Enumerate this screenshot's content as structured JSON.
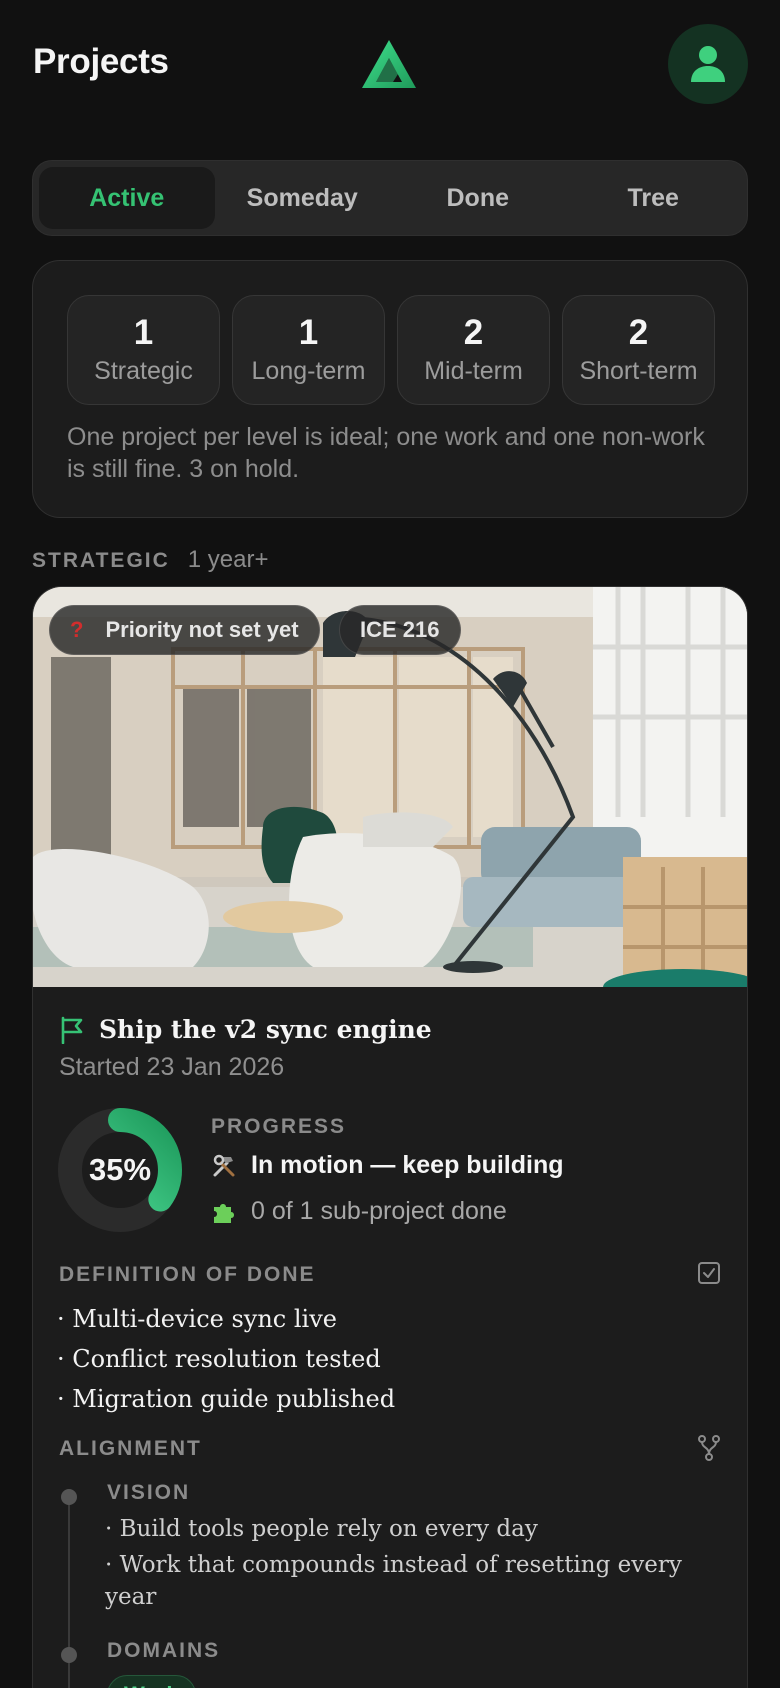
{
  "header": {
    "title": "Projects",
    "logo_icon": "triangle-logo-icon",
    "avatar_icon": "user-icon"
  },
  "tabs": [
    {
      "label": "Active",
      "selected": true
    },
    {
      "label": "Someday",
      "selected": false
    },
    {
      "label": "Done",
      "selected": false
    },
    {
      "label": "Tree",
      "selected": false
    }
  ],
  "levels": {
    "items": [
      {
        "count": "1",
        "label": "Strategic"
      },
      {
        "count": "1",
        "label": "Long-term"
      },
      {
        "count": "2",
        "label": "Mid-term"
      },
      {
        "count": "2",
        "label": "Short-term"
      }
    ],
    "note": "One project per level is ideal; one work and one non-work is still fine. 3 on hold."
  },
  "section": {
    "title": "STRATEGIC",
    "subtitle": "1 year+"
  },
  "project": {
    "priority_badge": "Priority not set yet",
    "priority_glyph": "?",
    "ice_badge": "ICE 216",
    "title": "Ship the v2 sync engine",
    "started": "Started 23 Jan 2026",
    "progress_percent_value": 35,
    "progress_percent_label": "35%",
    "progress_label": "PROGRESS",
    "status_icon": "hammer-wrench-icon",
    "status_text": "In motion — keep building",
    "subprojects_icon": "puzzle-icon",
    "subprojects_text": "0 of 1 sub-project done",
    "dod_label": "DEFINITION OF DONE",
    "dod_items": [
      "· Multi-device sync live",
      "· Conflict resolution tested",
      "· Migration guide published"
    ],
    "alignment_label": "ALIGNMENT",
    "vision_label": "VISION",
    "vision_items": [
      "· Build tools people rely on every day",
      "· Work that compounds instead of resetting every year"
    ],
    "domains_label": "DOMAINS",
    "domains": [
      "Work"
    ]
  },
  "colors": {
    "accent": "#35c273",
    "background": "#111111",
    "card": "#1c1c1c"
  }
}
